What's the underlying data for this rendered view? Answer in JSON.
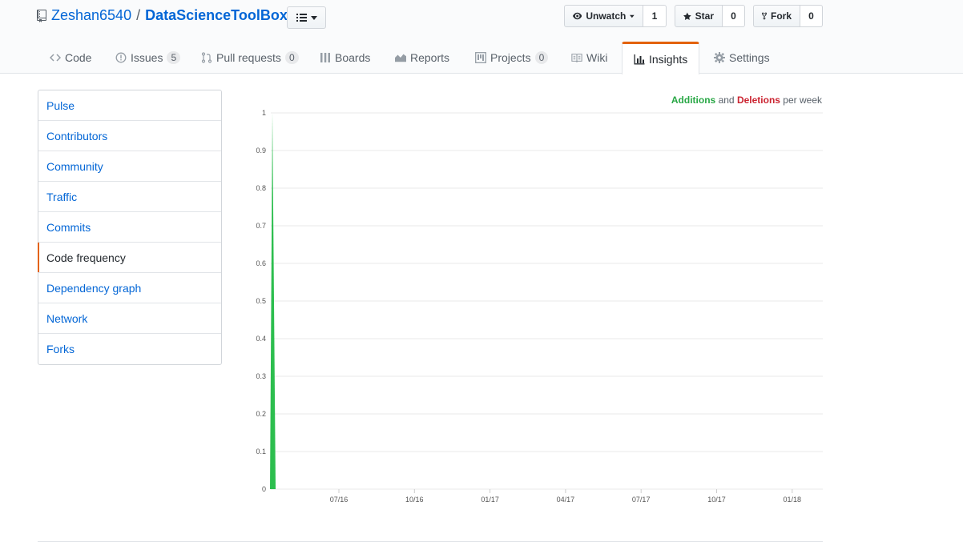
{
  "repo": {
    "owner": "Zeshan6540",
    "separator": "/",
    "name": "DataScienceToolBox"
  },
  "actions": {
    "watch": {
      "label": "Unwatch",
      "count": "1"
    },
    "star": {
      "label": "Star",
      "count": "0"
    },
    "fork": {
      "label": "Fork",
      "count": "0"
    }
  },
  "nav": {
    "code": "Code",
    "issues": "Issues",
    "issues_count": "5",
    "pulls": "Pull requests",
    "pulls_count": "0",
    "boards": "Boards",
    "reports": "Reports",
    "projects": "Projects",
    "projects_count": "0",
    "wiki": "Wiki",
    "insights": "Insights",
    "settings": "Settings"
  },
  "sidebar": {
    "items": [
      {
        "label": "Pulse"
      },
      {
        "label": "Contributors"
      },
      {
        "label": "Community"
      },
      {
        "label": "Traffic"
      },
      {
        "label": "Commits"
      },
      {
        "label": "Code frequency"
      },
      {
        "label": "Dependency graph"
      },
      {
        "label": "Network"
      },
      {
        "label": "Forks"
      }
    ],
    "selected_index": 5
  },
  "legend": {
    "additions": "Additions",
    "and": "and",
    "deletions": "Deletions",
    "per_week": "per week"
  },
  "colors": {
    "additions": "#2cbe4e",
    "deletions": "#cb2431",
    "accent": "#e36209",
    "link": "#0366d6"
  },
  "chart_data": {
    "type": "area",
    "ylim": [
      0,
      1
    ],
    "yticks": [
      "0",
      "0.1",
      "0.2",
      "0.3",
      "0.4",
      "0.5",
      "0.6",
      "0.7",
      "0.8",
      "0.9",
      "1"
    ],
    "xticks": [
      "07/16",
      "10/16",
      "01/17",
      "04/17",
      "07/17",
      "10/17",
      "01/18"
    ],
    "series": [
      {
        "name": "Additions",
        "x": [
          "04/16",
          "04/16",
          "04/16"
        ],
        "values": [
          0,
          1,
          0
        ]
      },
      {
        "name": "Deletions",
        "values": [
          0
        ]
      }
    ]
  }
}
